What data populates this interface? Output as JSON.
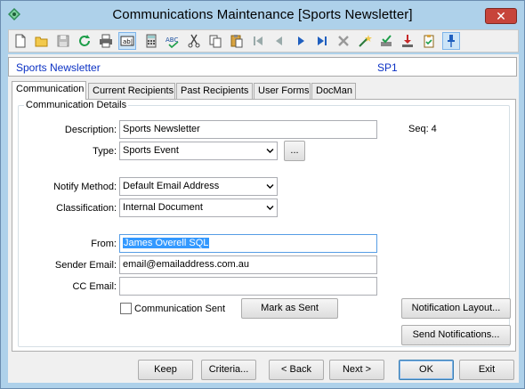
{
  "window": {
    "title": "Communications Maintenance  [Sports Newsletter]",
    "close_label": "✕"
  },
  "toolbar": {
    "buttons": [
      {
        "name": "new-icon"
      },
      {
        "name": "open-icon"
      },
      {
        "name": "save-icon"
      },
      {
        "name": "refresh-icon"
      },
      {
        "name": "print-icon"
      },
      {
        "name": "text-field-icon"
      },
      {
        "name": "calculator-icon"
      },
      {
        "name": "spellcheck-icon"
      },
      {
        "name": "cut-icon"
      },
      {
        "name": "copy-icon"
      },
      {
        "name": "paste-icon"
      },
      {
        "name": "first-record-icon"
      },
      {
        "name": "previous-record-icon"
      },
      {
        "name": "next-record-icon"
      },
      {
        "name": "last-record-icon"
      },
      {
        "name": "delete-icon"
      },
      {
        "name": "wand-icon"
      },
      {
        "name": "approve-icon"
      },
      {
        "name": "download-icon"
      },
      {
        "name": "clipboard-check-icon"
      },
      {
        "name": "pin-icon"
      }
    ]
  },
  "record": {
    "name": "Sports Newsletter",
    "code": "SP1"
  },
  "tabs": [
    {
      "label": "Communication"
    },
    {
      "label": "Current Recipients"
    },
    {
      "label": "Past Recipients"
    },
    {
      "label": "User Forms"
    },
    {
      "label": "DocMan"
    }
  ],
  "details": {
    "group_label": "Communication Details",
    "description_label": "Description:",
    "description_value": "Sports Newsletter",
    "seq_label": "Seq: 4",
    "type_label": "Type:",
    "type_value": "Sports Event",
    "browse_label": "...",
    "notify_label": "Notify Method:",
    "notify_value": "Default Email Address",
    "classification_label": "Classification:",
    "classification_value": "Internal Document",
    "from_label": "From:",
    "from_value": "James Overell SQL",
    "sender_label": "Sender Email:",
    "sender_value": "email@emailaddress.com.au",
    "cc_label": "CC Email:",
    "cc_value": "",
    "sent_label": "Communication Sent",
    "mark_sent_label": "Mark as Sent",
    "notification_layout_label": "Notification Layout...",
    "send_notifications_label": "Send  Notifications..."
  },
  "footer": {
    "keep": "Keep",
    "criteria": "Criteria...",
    "back": "< Back",
    "next": "Next >",
    "ok": "OK",
    "exit": "Exit"
  },
  "colors": {
    "frame": "#aed1ea",
    "record_text": "#0b31c4",
    "selection": "#3399ff",
    "close": "#c7443a"
  }
}
